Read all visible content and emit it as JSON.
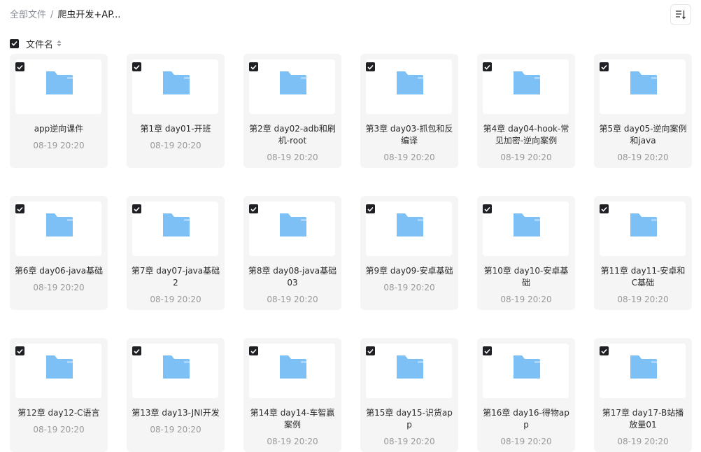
{
  "breadcrumb": {
    "root": "全部文件",
    "separator": "/",
    "current": "爬虫开发+AP..."
  },
  "list_header": {
    "label": "文件名",
    "select_all_checked": true
  },
  "colors": {
    "folder": "#7cc0f5",
    "folder_light": "#a9d6fa",
    "checkbox": "#1f2024",
    "card_bg": "#f5f5f6"
  },
  "folders": [
    {
      "name": "app逆向课件",
      "date": "08-19 20:20",
      "checked": true
    },
    {
      "name": "第1章 day01-开班",
      "date": "08-19 20:20",
      "checked": true
    },
    {
      "name": "第2章 day02-adb和刷机-root",
      "date": "08-19 20:20",
      "checked": true
    },
    {
      "name": "第3章 day03-抓包和反编译",
      "date": "08-19 20:20",
      "checked": true
    },
    {
      "name": "第4章 day04-hook-常见加密-逆向案例",
      "date": "08-19 20:20",
      "checked": true
    },
    {
      "name": "第5章 day05-逆向案例和java",
      "date": "08-19 20:20",
      "checked": true
    },
    {
      "name": "第6章 day06-java基础",
      "date": "08-19 20:20",
      "checked": true
    },
    {
      "name": "第7章 day07-java基础2",
      "date": "08-19 20:20",
      "checked": true
    },
    {
      "name": "第8章 day08-java基础03",
      "date": "08-19 20:20",
      "checked": true
    },
    {
      "name": "第9章 day09-安卓基础",
      "date": "08-19 20:20",
      "checked": true
    },
    {
      "name": "第10章 day10-安卓基础",
      "date": "08-19 20:20",
      "checked": true
    },
    {
      "name": "第11章 day11-安卓和C基础",
      "date": "08-19 20:20",
      "checked": true
    },
    {
      "name": "第12章 day12-C语言",
      "date": "08-19 20:20",
      "checked": true
    },
    {
      "name": "第13章 day13-JNI开发",
      "date": "08-19 20:20",
      "checked": true
    },
    {
      "name": "第14章 day14-车智赢案例",
      "date": "08-19 20:20",
      "checked": true
    },
    {
      "name": "第15章 day15-识货app",
      "date": "08-19 20:20",
      "checked": true
    },
    {
      "name": "第16章 day16-得物app",
      "date": "08-19 20:20",
      "checked": true
    },
    {
      "name": "第17章 day17-B站播放量01",
      "date": "08-19 20:20",
      "checked": true
    }
  ]
}
